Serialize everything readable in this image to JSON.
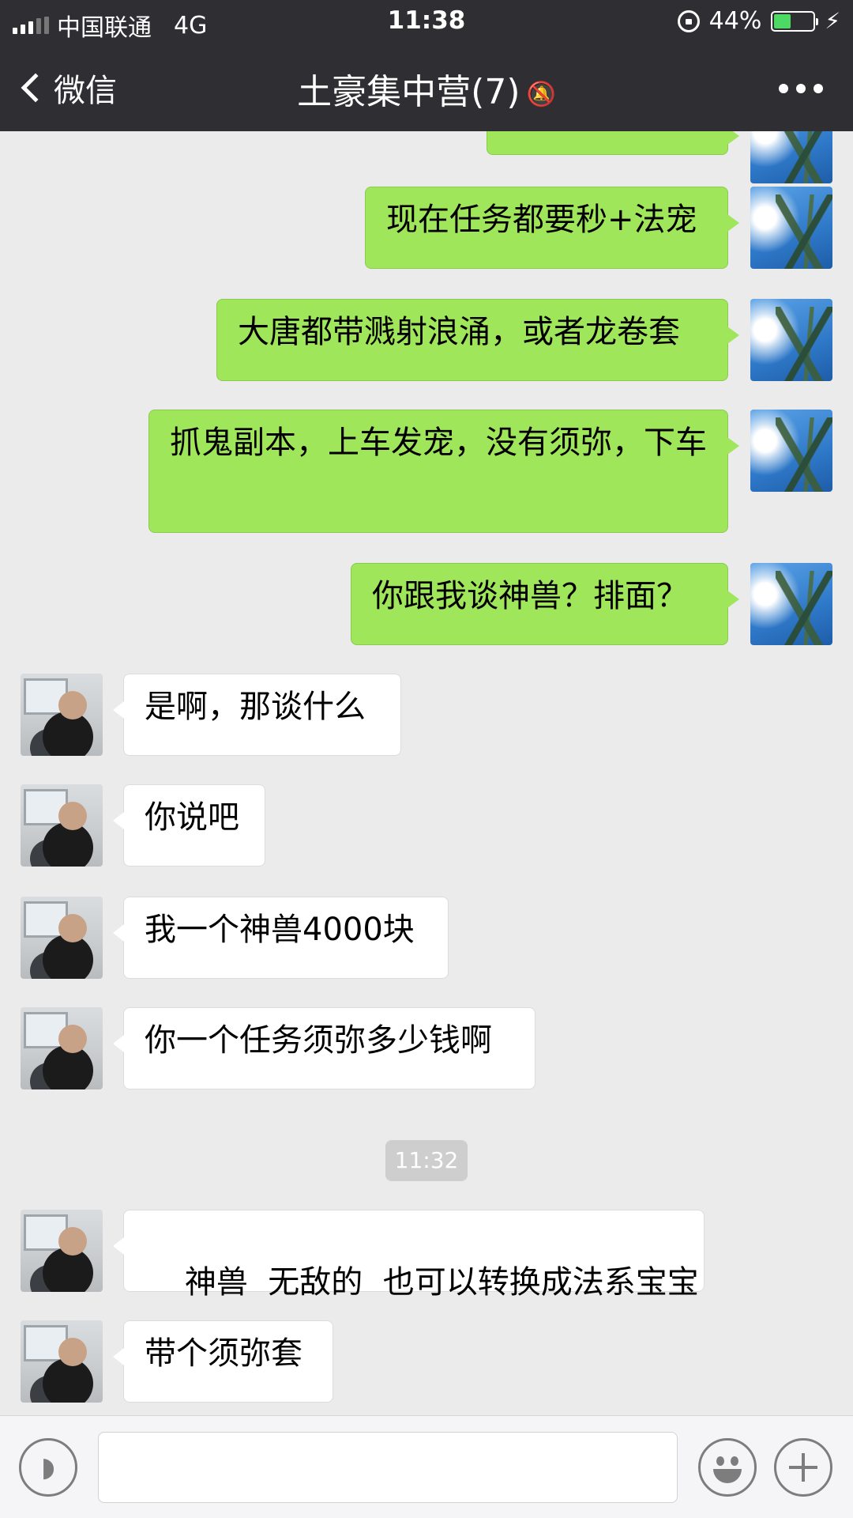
{
  "status_bar": {
    "carrier": "中国联通",
    "network": "4G",
    "time": "11:38",
    "battery": "44%",
    "battery_level": 0.44
  },
  "nav": {
    "back_label": "微信",
    "title": "土豪集中营(7)",
    "muted_icon": "bell-slash-icon",
    "more_icon": "more-dots-icon"
  },
  "messages": [
    {
      "side": "out",
      "text": "现在任务都要秒+法宠"
    },
    {
      "side": "out",
      "text": "大唐都带溅射浪涌，或者龙卷套"
    },
    {
      "side": "out",
      "text": "抓鬼副本，上车发宠，没有须弥，下车"
    },
    {
      "side": "out",
      "text": "你跟我谈神兽？排面？"
    },
    {
      "side": "in",
      "text": "是啊，那谈什么"
    },
    {
      "side": "in",
      "text": "你说吧"
    },
    {
      "side": "in",
      "text": "我一个神兽4000块"
    },
    {
      "side": "in",
      "text": "你一个任务须弥多少钱啊"
    },
    {
      "side": "in",
      "text": "神兽  无敌的  也可以转换成法系宝宝"
    },
    {
      "side": "in",
      "text": "带个须弥套"
    }
  ],
  "timestamp": "11:32",
  "input_bar": {
    "voice_icon": "voice-icon",
    "emoji_icon": "emoji-icon",
    "plus_icon": "plus-icon",
    "text_value": ""
  },
  "colors": {
    "nav_bg": "#2f2f33",
    "chat_bg": "#ebebeb",
    "outgoing_bubble": "#9fe65a",
    "incoming_bubble": "#ffffff"
  }
}
